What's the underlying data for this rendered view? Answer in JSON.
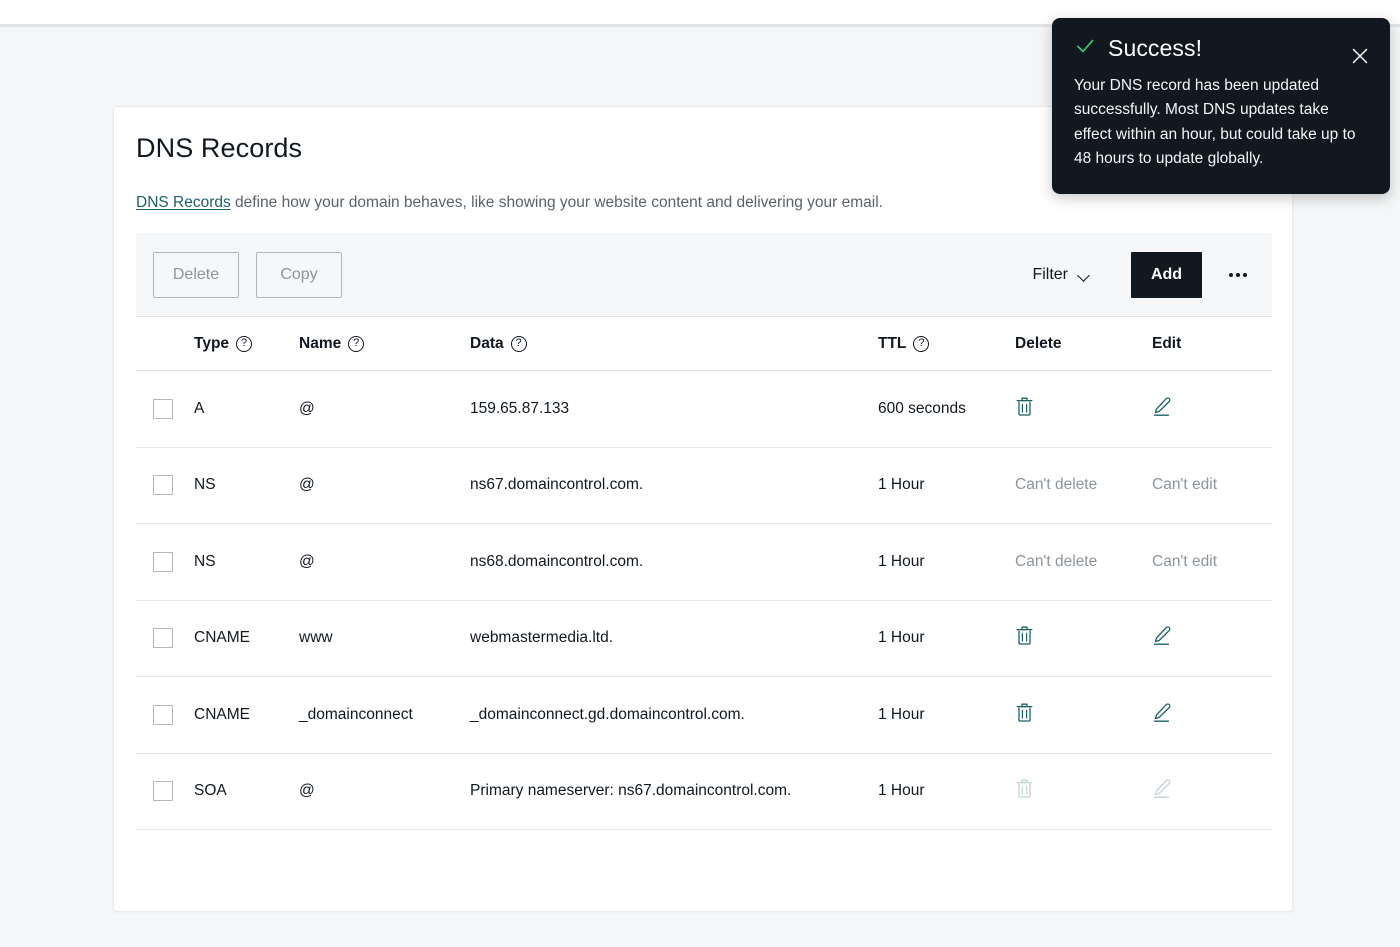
{
  "card": {
    "title": "DNS Records",
    "description_link": "DNS Records",
    "description_rest": " define how your domain behaves, like showing your website content and delivering your email."
  },
  "toolbar": {
    "delete_label": "Delete",
    "copy_label": "Copy",
    "filter_label": "Filter",
    "add_label": "Add",
    "more_label": "…"
  },
  "table": {
    "columns": {
      "type": "Type",
      "name": "Name",
      "data": "Data",
      "ttl": "TTL",
      "delete": "Delete",
      "edit": "Edit"
    },
    "help_glyph": "?",
    "cant_delete": "Can't delete",
    "cant_edit": "Can't edit",
    "rows": [
      {
        "type": "A",
        "name": "@",
        "data": "159.65.87.133",
        "ttl": "600 seconds",
        "delete_state": "icon",
        "edit_state": "icon"
      },
      {
        "type": "NS",
        "name": "@",
        "data": "ns67.domaincontrol.com.",
        "ttl": "1 Hour",
        "delete_state": "text",
        "edit_state": "text"
      },
      {
        "type": "NS",
        "name": "@",
        "data": "ns68.domaincontrol.com.",
        "ttl": "1 Hour",
        "delete_state": "text",
        "edit_state": "text"
      },
      {
        "type": "CNAME",
        "name": "www",
        "data": "webmastermedia.ltd.",
        "ttl": "1 Hour",
        "delete_state": "icon",
        "edit_state": "icon"
      },
      {
        "type": "CNAME",
        "name": "_domainconnect",
        "data": "_domainconnect.gd.domaincontrol.com.",
        "ttl": "1 Hour",
        "delete_state": "icon",
        "edit_state": "icon"
      },
      {
        "type": "SOA",
        "name": "@",
        "data": "Primary nameserver: ns67.domaincontrol.com.",
        "ttl": "1 Hour",
        "delete_state": "icon-disabled",
        "edit_state": "icon-disabled"
      }
    ]
  },
  "toast": {
    "title": "Success!",
    "message": "Your DNS record has been updated successfully. Most DNS updates take effect within an hour, but could take up to 48 hours to update globally."
  },
  "colors": {
    "accent_dark": "#111820",
    "link": "#1b6066",
    "icon_teal": "#1b6066",
    "icon_disabled": "#c3d3d6",
    "success_check": "#3fcc6e",
    "page_bg": "#f4f6f7",
    "toolbar_bg": "#f6f7f8"
  }
}
